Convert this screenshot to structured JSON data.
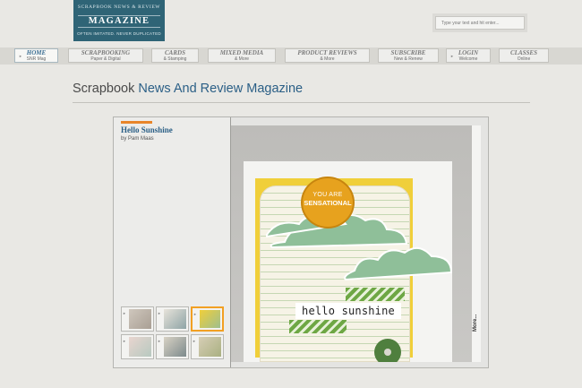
{
  "header": {
    "logo": {
      "line1": "SCRAPBOOK NEWS & REVIEW",
      "line2": "MAGAZINE",
      "line3": "OFTEN IMITATED. NEVER DUPLICATED"
    },
    "search": {
      "placeholder": "Type your text and hit enter..."
    }
  },
  "nav": {
    "items": [
      {
        "title": "HOME",
        "sub": "SNR Mag"
      },
      {
        "title": "SCRAPBOOKING",
        "sub": "Paper & Digital"
      },
      {
        "title": "CARDS",
        "sub": "& Stamping"
      },
      {
        "title": "MIXED MEDIA",
        "sub": "& More"
      },
      {
        "title": "PRODUCT REVIEWS",
        "sub": "& More"
      },
      {
        "title": "SUBSCRIBE",
        "sub": "New & Renew"
      },
      {
        "title": "LOGIN",
        "sub": "Welcome"
      },
      {
        "title": "CLASSES",
        "sub": "Online"
      }
    ]
  },
  "page": {
    "title_plain": "Scrapbook",
    "title_accent": "News And Review Magazine"
  },
  "feature": {
    "title": "Hello Sunshine",
    "byline": "by Pam Maas",
    "badge_line1": "YOU ARE",
    "badge_line2": "SENSATIONAL",
    "sentiment": "hello sunshine",
    "more_label": "More..."
  },
  "colors": {
    "brand": "#2f6476",
    "accent_link": "#2b5f86",
    "orange": "#e8852a",
    "background": "#e9e8e4"
  }
}
